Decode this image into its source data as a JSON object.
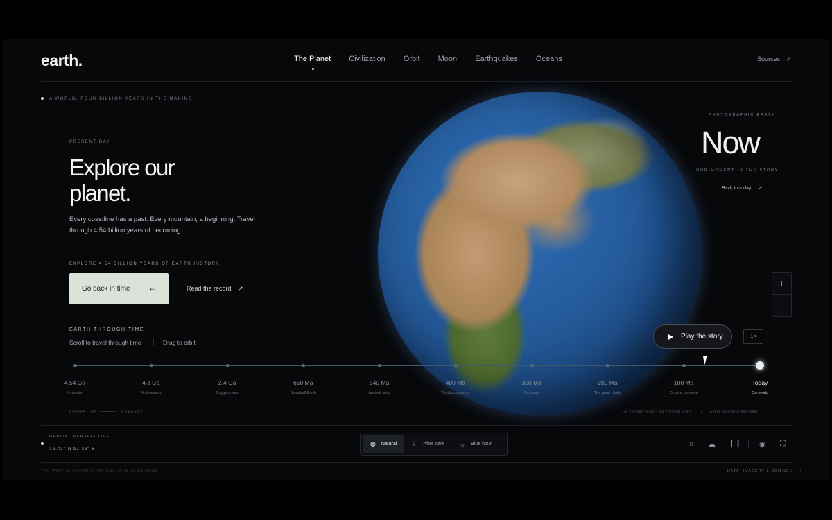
{
  "brand": {
    "logo": "earth."
  },
  "nav": {
    "items": [
      "The Planet",
      "Civilization",
      "Orbit",
      "Moon",
      "Earthquakes",
      "Oceans"
    ],
    "active_index": 0,
    "sources_label": "Sources"
  },
  "intro": {
    "kicker": "A WORLD, FOUR BILLION YEARS IN THE MAKING",
    "eyebrow": "PRESENT DAY",
    "headline_line1": "Explore our",
    "headline_line2": "planet.",
    "description": "Every coastline has a past. Every mountain, a beginning. Travel through 4.54 billion years of becoming.",
    "cta_caption": "EXPLORE 4.54 BILLION YEARS OF EARTH HISTORY",
    "primary_button": "Go back in time",
    "secondary_link": "Read the record",
    "time_section_title": "EARTH THROUGH TIME",
    "hint_scroll": "Scroll to travel through time",
    "hint_drag": "Drag to orbit"
  },
  "now_panel": {
    "kicker": "PHOTOGRAPHIC EARTH",
    "title": "Now",
    "subtitle": "OUR MOMENT IN THE STORY",
    "back_link": "Back to today"
  },
  "zoom": {
    "in": "+",
    "out": "−"
  },
  "player": {
    "play_label": "Play the story",
    "speed": "1×"
  },
  "timeline": {
    "events": [
      {
        "age": "4.54 Ga",
        "label": "Formation"
      },
      {
        "age": "4.3 Ga",
        "label": "First oceans"
      },
      {
        "age": "2.4 Ga",
        "label": "Oxygen rises"
      },
      {
        "age": "650 Ma",
        "label": "Snowball Earth"
      },
      {
        "age": "540 Ma",
        "label": "Ancient seas"
      },
      {
        "age": "400 Ma",
        "label": "Worlds converge"
      },
      {
        "age": "300 Ma",
        "label": "Pangaea"
      },
      {
        "age": "200 Ma",
        "label": "The great divide"
      },
      {
        "age": "100 Ma",
        "label": "Oceans between"
      },
      {
        "age": "Today",
        "label": "Our world"
      }
    ],
    "current_index": 9,
    "legend_left_start": "FORMATION",
    "legend_left_end": "PRESENT",
    "legend_units": "Ga = billion years · Ma = million years",
    "legend_note": "Event spacing is not linear"
  },
  "footer": {
    "perspective_label": "ORBITAL PERSPECTIVE",
    "coordinates": "15.41° N 51.38° E",
    "modes": [
      "Natural",
      "After dark",
      "Blue hour"
    ],
    "active_mode": 0,
    "bottom_left": "THE PAST IS ANOTHER WORLD. IT IS ALSO OURS.",
    "bottom_right": "DATA, IMAGERY & SCIENCE"
  },
  "colors": {
    "background": "#07080a",
    "button_bg": "#dbe2da",
    "accent_line": "#3c5a68"
  }
}
